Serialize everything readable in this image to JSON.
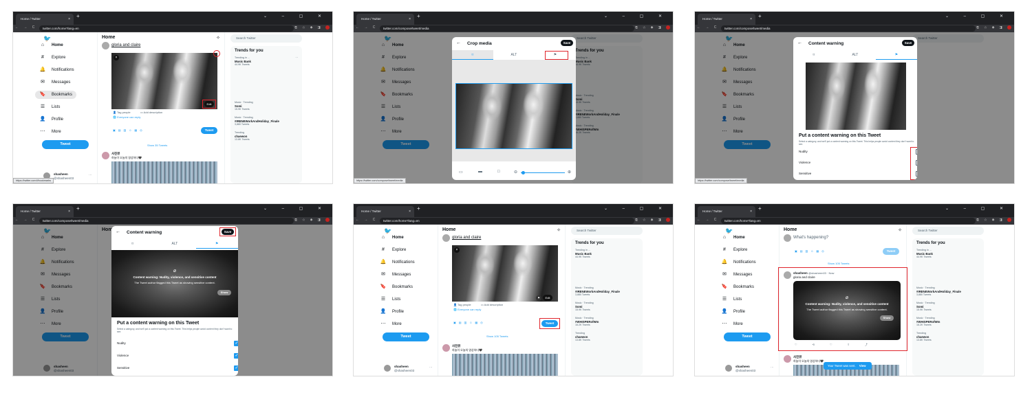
{
  "browser": {
    "tab_title": "Home / Twitter",
    "tab_close": "×",
    "new_tab": "+",
    "window_controls": "⌄ – ▢ ✕",
    "nav_buttons": "← → C",
    "url_home": "twitter.com/home?lang=en",
    "url_media": "twitter.com/compose/tweet/media",
    "url_domain": "twitter.com",
    "ext_icons": "⧉ ☆ ✱ ◨"
  },
  "sidebar": {
    "logo": "🐦",
    "items": [
      {
        "icon": "⌂",
        "label": "Home"
      },
      {
        "icon": "#",
        "label": "Explore"
      },
      {
        "icon": "🔔",
        "label": "Notifications"
      },
      {
        "icon": "✉",
        "label": "Messages"
      },
      {
        "icon": "🔖",
        "label": "Bookmarks"
      },
      {
        "icon": "☰",
        "label": "Lists"
      },
      {
        "icon": "👤",
        "label": "Profile"
      },
      {
        "icon": "⋯",
        "label": "More"
      }
    ],
    "tweet_button": "Tweet",
    "profile_name": "shasheen",
    "profile_handle": "@shasheen03",
    "more": "···"
  },
  "main": {
    "title": "Home",
    "spark_icon": "✧",
    "compose_text": "gloria and claire",
    "whats_happening": "What's happening?",
    "tag_people": "Tag people",
    "add_description": "Add description",
    "everyone_reply": "Everyone can reply",
    "edit_label": "Edit",
    "tweet_label": "Tweet",
    "show_tweets": "Show 35 Tweets",
    "show_tweets_2": "Show 105 Tweets",
    "post_user": "사진뷰",
    "post_meta": "@lSK 31 · 21h",
    "post_text": "하늘이 오늘의 영상하다🖤",
    "sent_user": "shasheen",
    "sent_handle": "@shasheen03 · Now",
    "sent_text": "gloria and claire",
    "toast": "Your Tweet was sent.",
    "toast_view": "View",
    "tooltip_bookmarks": "https://twitter.com/i/bookmarks",
    "tooltip_media": "https://twitter.com/compose/tweet/media"
  },
  "right": {
    "search_placeholder": "Search Twitter",
    "trends_title": "Trends for you",
    "trends": [
      {
        "meta": "Trending in ...",
        "name": "Music Bank",
        "count": "44.9K Tweets"
      },
      {
        "meta": "Music · Trending",
        "name": "Somi",
        "count": "15.9K Tweets"
      },
      {
        "meta": "Music · Trending",
        "name": "#IRENEWorkAndHoliday_Finale",
        "count": "3,880 Tweets"
      },
      {
        "meta": "Music · Trending",
        "name": "#WHISPERofWIn",
        "count": "16.2K Tweets"
      },
      {
        "meta": "Trending",
        "name": "chaewon",
        "count": "13.8K Tweets"
      }
    ]
  },
  "crop_modal": {
    "title": "Crop media",
    "save": "Save",
    "tab_alt": "ALT",
    "tab_crop": "⌑",
    "tab_flag": "⚑",
    "zoom_minus": "⊖",
    "zoom_plus": "⊕"
  },
  "cw_modal": {
    "title": "Content warning",
    "save": "Save",
    "heading": "Put a content warning on this Tweet",
    "description": "Select a category, and we'll put a content warning on this Tweet. This helps people avoid content they don't want to see.",
    "options": [
      "Nudity",
      "Violence",
      "Sensitive"
    ],
    "blur_title": "Content warning: Nudity, violence, and sensitive content",
    "blur_sub": "The Tweet author flagged this Tweet as showing sensitive content.",
    "show": "Show",
    "eye_icon": "⌀"
  },
  "colors": {
    "accent": "#1d9bf0",
    "highlight": "#e0242b",
    "text": "#0f1419"
  }
}
